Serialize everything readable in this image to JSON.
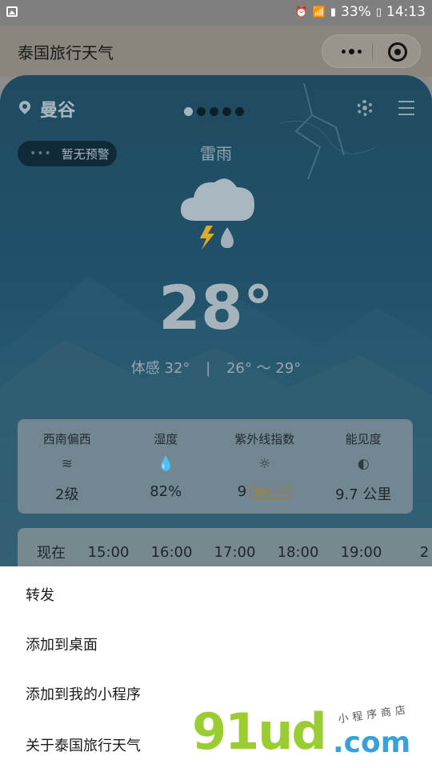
{
  "status_bar": {
    "battery": "33%",
    "time": "14:13",
    "icons": [
      "image-icon",
      "alarm-icon",
      "wifi-icon",
      "signal-icon",
      "signal-icon",
      "battery-icon"
    ]
  },
  "app_bar": {
    "title": "泰国旅行天气",
    "more_icon": "more-dots-icon",
    "close_icon": "target-close-icon"
  },
  "weather": {
    "city": "曼谷",
    "warning": "暂无预警",
    "condition": "雷雨",
    "temperature": "28°",
    "feels_like": "体感 32°",
    "range": "26° ～ 29°",
    "page_count": 5,
    "active_page": 0,
    "icon": "thunder-rain-cloud-icon"
  },
  "details": [
    {
      "label": "西南偏西",
      "icon": "wind-icon",
      "value": "2级"
    },
    {
      "label": "湿度",
      "icon": "drop-icon",
      "value": "82%"
    },
    {
      "label": "紫外线指数",
      "icon": "sun-icon",
      "value": "9",
      "badge": "最大 10"
    },
    {
      "label": "能见度",
      "icon": "half-circle-icon",
      "value": "9.7 公里"
    }
  ],
  "hourly": [
    "现在",
    "15:00",
    "16:00",
    "17:00",
    "18:00",
    "19:00",
    "2"
  ],
  "sheet": {
    "items": [
      "转发",
      "添加到桌面",
      "添加到我的小程序",
      "关于泰国旅行天气"
    ]
  },
  "watermark": {
    "big": "91ud",
    "dot": ".com",
    "small": "小程序商店"
  },
  "colors": {
    "panel_top": "#1f4b60",
    "panel_bottom": "#4b7486",
    "watermark_green": "#9acd32",
    "watermark_blue": "#3aa0d8"
  }
}
